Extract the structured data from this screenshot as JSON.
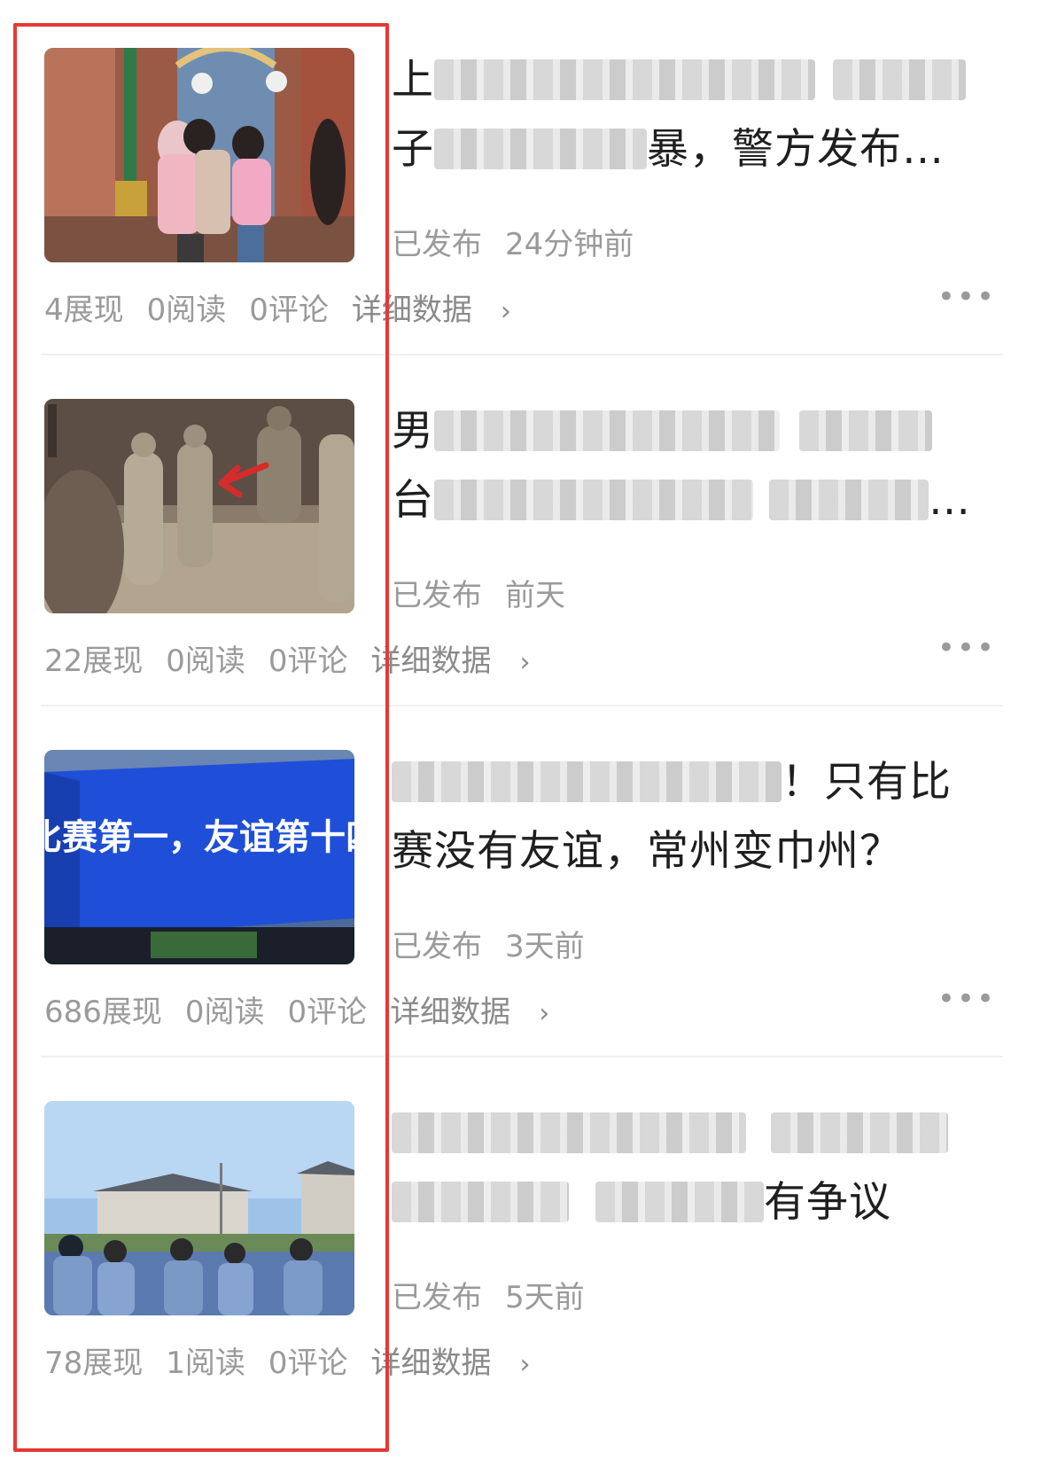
{
  "articles": [
    {
      "title_line1_vis": "上",
      "title_line1_end": "",
      "title_line2_vis": "子",
      "title_line2_end": "暴，警方发布…",
      "status": "已发布",
      "time": "24分钟前",
      "impressions": "4展现",
      "reads": "0阅读",
      "comments": "0评论",
      "detail": "详细数据",
      "image_icon": "theme-park-hug-photo"
    },
    {
      "title_line1_vis": "男",
      "title_line1_end": "",
      "title_line2_vis": "台",
      "title_line2_end": "…",
      "status": "已发布",
      "time": "前天",
      "impressions": "22展现",
      "reads": "0阅读",
      "comments": "0评论",
      "detail": "详细数据",
      "image_icon": "terracotta-warriors-photo"
    },
    {
      "title_line1_vis": "",
      "title_line1_end": "！只有比",
      "title_line2_vis": "赛没有友谊，常州变巾州？",
      "title_line2_end": "",
      "status": "已发布",
      "time": "3天前",
      "impressions": "686展现",
      "reads": "0阅读",
      "comments": "0评论",
      "detail": "详细数据",
      "image_icon": "led-building-photo",
      "image_text": "比赛第一，友谊第十四"
    },
    {
      "title_line1_vis": "",
      "title_line1_end": "",
      "title_line2_vis": "",
      "title_line2_end": "有争议",
      "status": "已发布",
      "time": "5天前",
      "impressions": "78展现",
      "reads": "1阅读",
      "comments": "0评论",
      "detail": "详细数据",
      "image_icon": "police-assembly-photo"
    }
  ],
  "chevron": "›",
  "more": "•••",
  "colors": {
    "highlight_border": "#e53935",
    "meta_text": "#9a9a9a",
    "title_text": "#1f1f1f"
  }
}
